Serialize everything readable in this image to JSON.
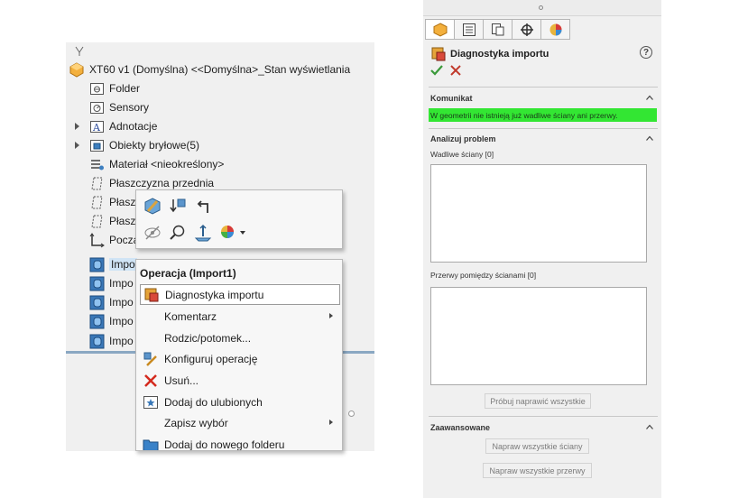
{
  "feature_tree": {
    "root_label": "XT60 v1 (Domyślna) <<Domyślna>_Stan wyświetlania",
    "items": [
      {
        "label": "Folder",
        "icon": "folder-icon"
      },
      {
        "label": "Sensory",
        "icon": "sensor-icon"
      },
      {
        "label": "Adnotacje",
        "icon": "annotation-icon"
      },
      {
        "label": "Obiekty bryłowe(5)",
        "icon": "solid-bodies-icon"
      },
      {
        "label": "Materiał <nieokreślony>",
        "icon": "material-icon"
      },
      {
        "label": "Płaszczyzna przednia",
        "icon": "plane-icon"
      },
      {
        "label": "Płaszc",
        "icon": "plane-icon"
      },
      {
        "label": "Płaszc",
        "icon": "plane-icon"
      },
      {
        "label": "Pocza",
        "icon": "origin-icon"
      },
      {
        "label": "Impo",
        "icon": "import-feature-icon"
      },
      {
        "label": "Impo",
        "icon": "import-feature-icon"
      },
      {
        "label": "Impo",
        "icon": "import-feature-icon"
      },
      {
        "label": "Impo",
        "icon": "import-feature-icon"
      },
      {
        "label": "Impo",
        "icon": "import-feature-icon"
      }
    ]
  },
  "context_menu": {
    "header": "Operacja (Import1)",
    "items": [
      {
        "label": "Diagnostyka importu",
        "icon": "import-diagnostics-icon"
      },
      {
        "label": "Komentarz",
        "icon": ""
      },
      {
        "label": "Rodzic/potomek...",
        "icon": ""
      },
      {
        "label": "Konfiguruj operację",
        "icon": "configure-feature-icon"
      },
      {
        "label": "Usuń...",
        "icon": "delete-icon"
      },
      {
        "label": "Dodaj do ulubionych",
        "icon": "favorites-icon"
      },
      {
        "label": "Zapisz wybór",
        "icon": ""
      },
      {
        "label": "Dodaj do nowego folderu",
        "icon": "new-folder-icon"
      }
    ]
  },
  "property_manager": {
    "title": "Diagnostyka importu",
    "help": "?",
    "message_section": {
      "title": "Komunikat",
      "message": "W geometrii nie istnieją już wadliwe ściany ani przerwy."
    },
    "analyze_section": {
      "title": "Analizuj problem",
      "faulty_faces_label": "Wadliwe ściany [0]",
      "gaps_label": "Przerwy pomiędzy ścianami [0]",
      "try_repair_button": "Próbuj naprawić wszystkie"
    },
    "advanced_section": {
      "title": "Zaawansowane",
      "repair_faces_button": "Napraw wszystkie ściany",
      "repair_gaps_button": "Napraw wszystkie przerwy"
    }
  },
  "colors": {
    "message_bg": "#33e633",
    "ok_green": "#3a9a3a",
    "cancel_red": "#c0392b"
  }
}
